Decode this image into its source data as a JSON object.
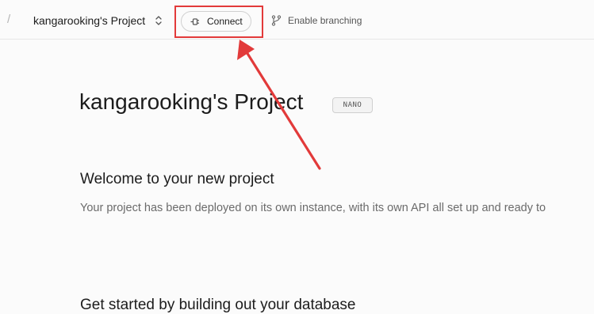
{
  "header": {
    "separator": "/",
    "project_name": "kangarooking's Project",
    "connect_label": "Connect",
    "branching_label": "Enable branching"
  },
  "main": {
    "title": "kangarooking's Project",
    "tier_badge": "NANO",
    "welcome_heading": "Welcome to your new project",
    "welcome_text": "Your project has been deployed on its own instance, with its own API all set up and ready to",
    "database_heading": "Get started by building out your database"
  },
  "annotation": {
    "color": "#e23a3a"
  },
  "icons": {
    "project_switcher": "chevron-up-down-icon",
    "connect": "plug-icon",
    "branching": "git-branch-icon"
  }
}
